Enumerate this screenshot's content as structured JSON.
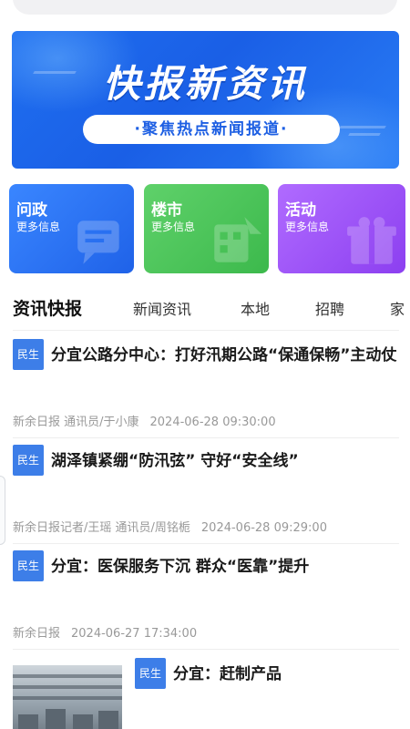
{
  "banner": {
    "title": "快报新资讯",
    "subtitle": "·聚焦热点新闻报道·"
  },
  "categories": [
    {
      "title": "问政",
      "subtitle": "更多信息",
      "color": "#2f7bf8"
    },
    {
      "title": "楼市",
      "subtitle": "更多信息",
      "color": "#4cc55a"
    },
    {
      "title": "活动",
      "subtitle": "更多信息",
      "color": "#9e55f7"
    }
  ],
  "tabs": {
    "main": "资讯快报",
    "items": [
      "新闻资讯",
      "本地",
      "招聘",
      "家"
    ]
  },
  "news": [
    {
      "tag": "民生",
      "title": "分宜公路分中心：打好汛期公路“保通保畅”主动仗",
      "source": "新余日报 通讯员/于小康",
      "time": "2024-06-28 09:30:00"
    },
    {
      "tag": "民生",
      "title": "湖泽镇紧绷“防汛弦” 守好“安全线”",
      "source": "新余日报记者/王瑶 通讯员/周铭栀",
      "time": "2024-06-28 09:29:00"
    },
    {
      "tag": "民生",
      "title": "分宜：医保服务下沉 群众“医靠”提升",
      "source": "新余日报",
      "time": "2024-06-27 17:34:00"
    },
    {
      "tag": "民生",
      "title": "分宜：赶制产品"
    }
  ],
  "colors": {
    "accent": "#3d7ee8",
    "banner": "#1f6ff0"
  }
}
